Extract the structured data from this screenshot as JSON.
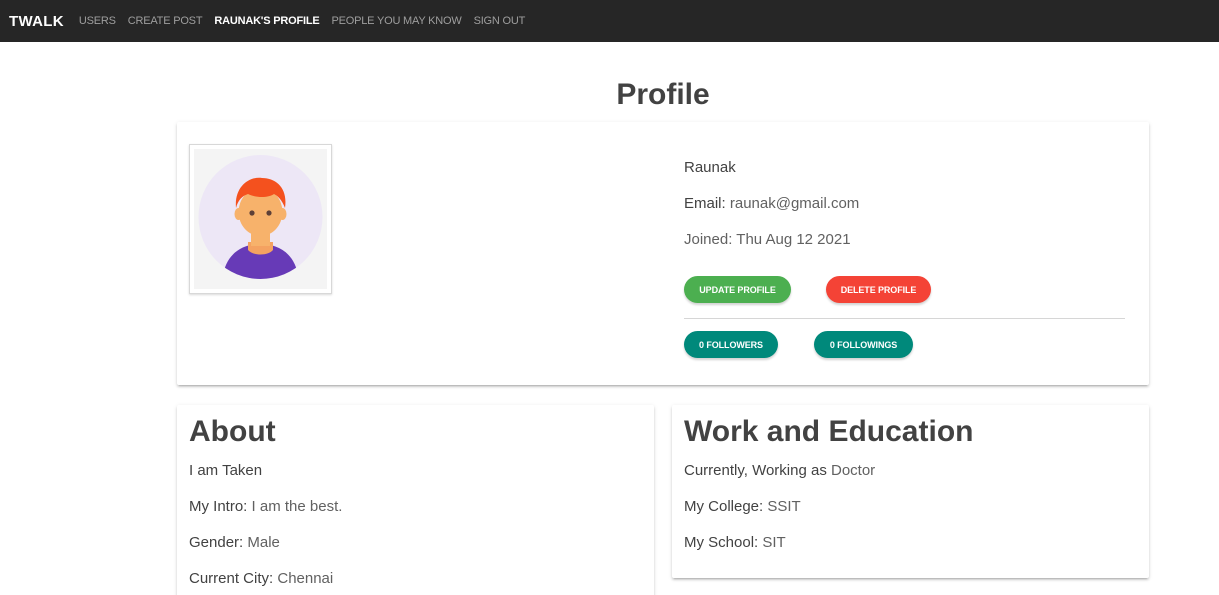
{
  "navbar": {
    "brand": "TWALK",
    "links": [
      "USERS",
      "CREATE POST",
      "RAUNAK'S PROFILE",
      "PEOPLE YOU MAY KNOW",
      "SIGN OUT"
    ],
    "active_index": 2
  },
  "page_title": "Profile",
  "profile": {
    "name": "Raunak",
    "email_label": "Email:",
    "email": "raunak@gmail.com",
    "joined_label": "Joined:",
    "joined": "Thu Aug 12 2021",
    "update_button": "UPDATE PROFILE",
    "delete_button": "DELETE PROFILE",
    "followers_button": "0 FOLLOWERS",
    "followings_button": "0 FOLLOWINGS"
  },
  "about": {
    "title": "About",
    "status": "I am Taken",
    "intro_label": "My Intro:",
    "intro": "I am the best.",
    "gender_label": "Gender:",
    "gender": "Male",
    "city_label": "Current City:",
    "city": "Chennai"
  },
  "work": {
    "title": "Work and Education",
    "working_label": "Currently, Working as",
    "working": "Doctor",
    "college_label": "My College:",
    "college": "SSIT",
    "school_label": "My School:",
    "school": "SIT"
  },
  "colors": {
    "navbar_bg": "#262626",
    "update_green": "#4caf50",
    "delete_red": "#f44336",
    "follow_teal": "#00897b"
  }
}
